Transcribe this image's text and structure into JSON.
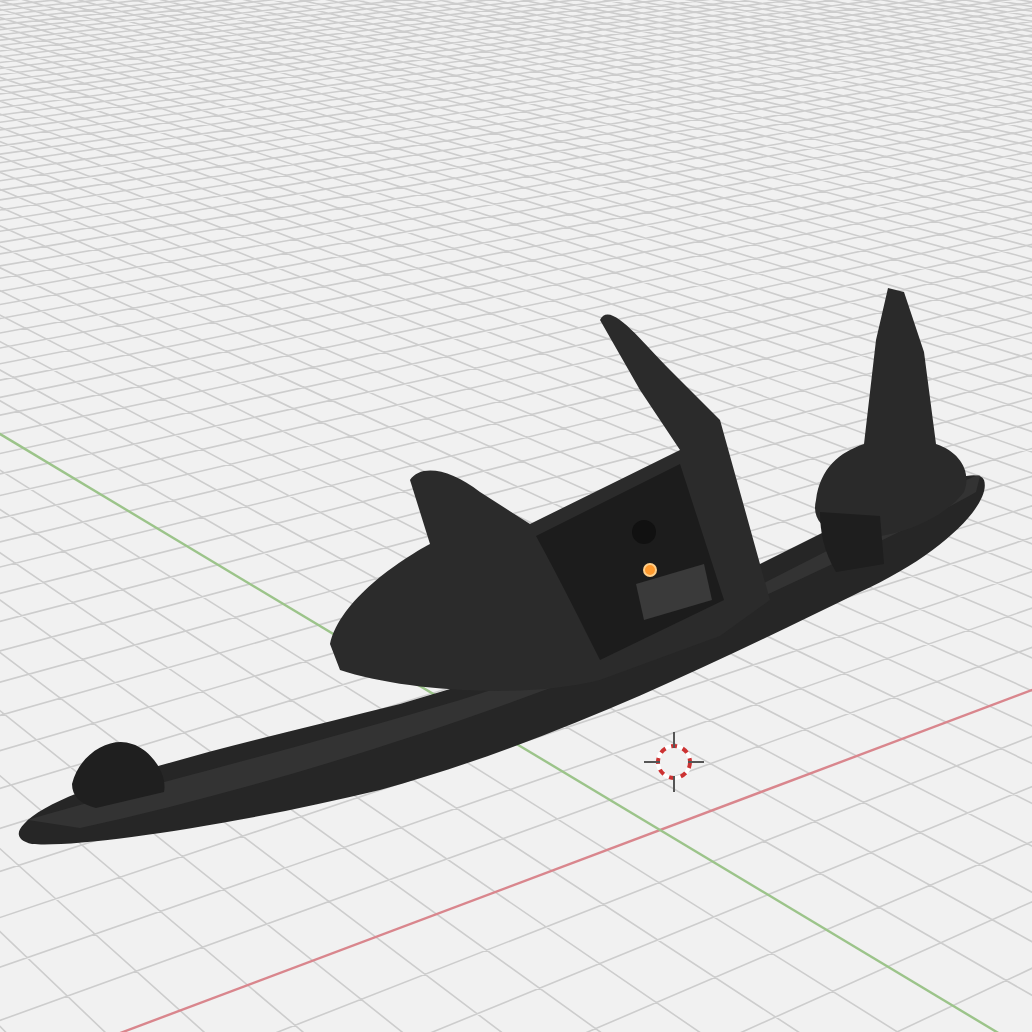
{
  "viewport": {
    "show_grid": true,
    "show_axes": true,
    "show_cursor": true,
    "show_origin": true
  }
}
